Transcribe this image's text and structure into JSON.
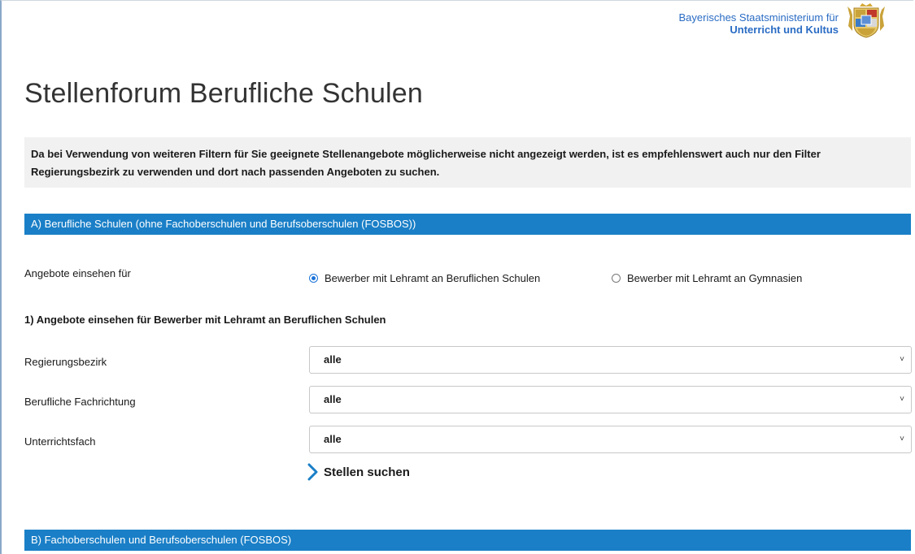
{
  "header": {
    "org_line1": "Bayerisches Staatsministerium für",
    "org_line2": "Unterricht und Kultus",
    "crest_icon": "bavarian-coat-of-arms"
  },
  "page": {
    "title": "Stellenforum Berufliche Schulen",
    "notice": "Da bei Verwendung von weiteren Filtern für Sie geeignete Stellenangebote möglicherweise nicht angezeigt werden, ist es empfehlenswert auch nur den Filter Regierungsbezirk zu verwenden und dort nach passenden Angeboten zu suchen."
  },
  "section_a": {
    "title": "A) Berufliche Schulen (ohne Fachoberschulen und Berufsoberschulen (FOSBOS))",
    "view_label": "Angebote einsehen für",
    "radio_options": [
      {
        "label": "Bewerber mit Lehramt an Beruflichen Schulen",
        "selected": true
      },
      {
        "label": "Bewerber mit Lehramt an Gymnasien",
        "selected": false
      }
    ],
    "subheading": "1) Angebote einsehen für Bewerber mit Lehramt an Beruflichen Schulen",
    "filters": [
      {
        "label": "Regierungsbezirk",
        "value": "alle"
      },
      {
        "label": "Berufliche Fachrichtung",
        "value": "alle"
      },
      {
        "label": "Unterrichtsfach",
        "value": "alle"
      }
    ],
    "search_label": "Stellen suchen"
  },
  "section_b": {
    "title": "B) Fachoberschulen und Berufsoberschulen (FOSBOS)"
  },
  "colors": {
    "accent": "#1a7fc7",
    "org_text": "#2a6cc4",
    "notice_bg": "#f1f1f1"
  }
}
